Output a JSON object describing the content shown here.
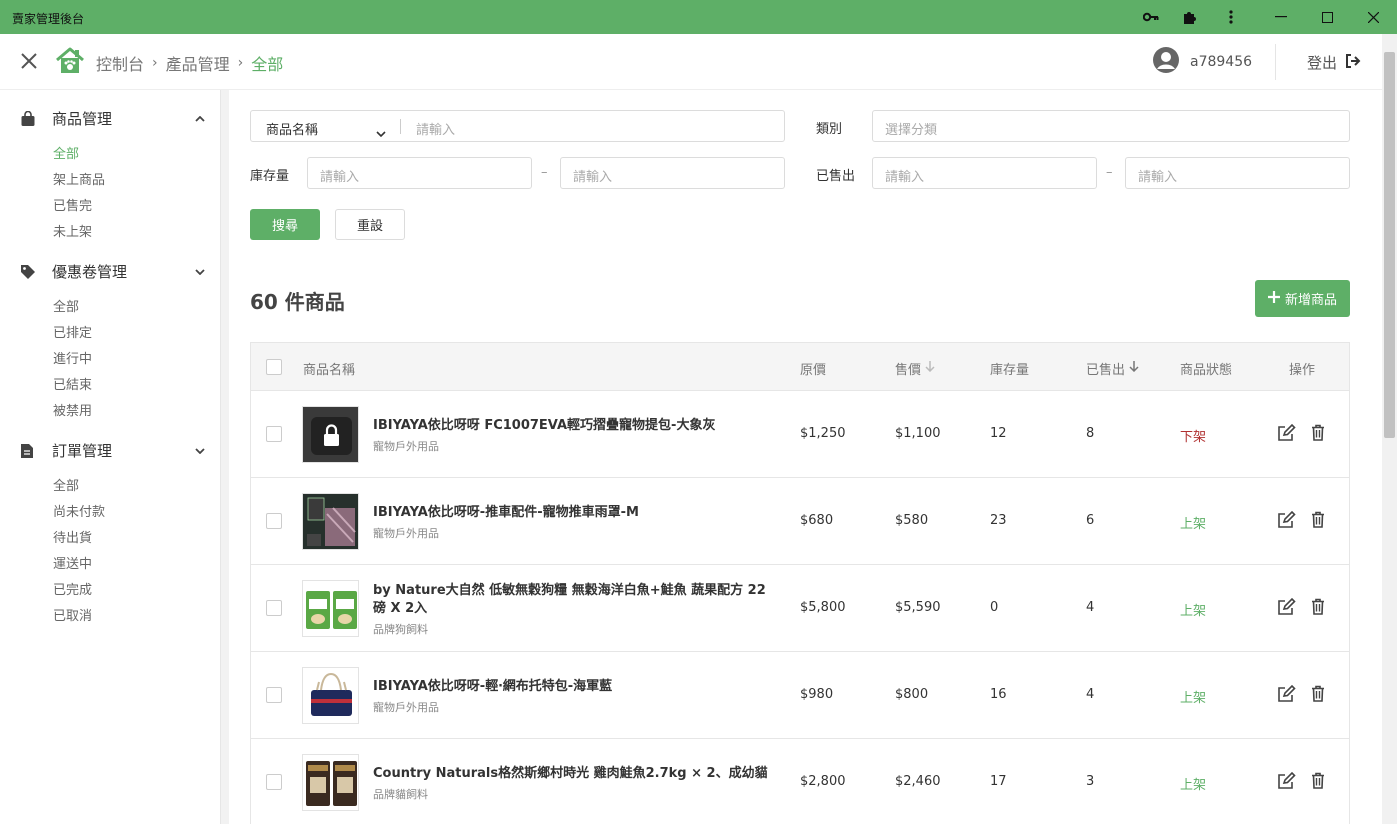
{
  "window": {
    "title": "賣家管理後台"
  },
  "header": {
    "breadcrumb": [
      "控制台",
      "產品管理",
      "全部"
    ],
    "username": "a789456",
    "logout_label": "登出"
  },
  "sidebar": {
    "groups": [
      {
        "label": "商品管理",
        "icon": "shopping-bag-icon",
        "expanded": true,
        "items": [
          "全部",
          "架上商品",
          "已售完",
          "未上架"
        ],
        "active_index": 0
      },
      {
        "label": "優惠卷管理",
        "icon": "tag-icon",
        "expanded": false,
        "items": [
          "全部",
          "已排定",
          "進行中",
          "已結束",
          "被禁用"
        ]
      },
      {
        "label": "訂單管理",
        "icon": "document-icon",
        "expanded": false,
        "items": [
          "全部",
          "尚未付款",
          "待出貨",
          "運送中",
          "已完成",
          "已取消"
        ]
      }
    ]
  },
  "filters": {
    "name_select": "商品名稱",
    "name_placeholder": "請輸入",
    "category_label": "類別",
    "category_placeholder": "選擇分類",
    "stock_label": "庫存量",
    "sold_label": "已售出",
    "range_placeholder": "請輸入",
    "range_dash": "–",
    "search_button": "搜尋",
    "reset_button": "重設"
  },
  "list": {
    "count_title": "60 件商品",
    "add_button": "新增商品"
  },
  "table": {
    "columns": [
      "商品名稱",
      "原價",
      "售價",
      "庫存量",
      "已售出",
      "商品狀態",
      "操作"
    ],
    "rows": [
      {
        "name": "IBIYAYA依比呀呀 FC1007EVA輕巧摺疊寵物提包-大象灰",
        "category": "寵物戶外用品",
        "original_price": "$1,250",
        "price": "$1,100",
        "stock": "12",
        "sold": "8",
        "status": "下架",
        "status_type": "off",
        "thumb": "locked-bag"
      },
      {
        "name": "IBIYAYA依比呀呀-推車配件-寵物推車雨罩-M",
        "category": "寵物戶外用品",
        "original_price": "$680",
        "price": "$580",
        "stock": "23",
        "sold": "6",
        "status": "上架",
        "status_type": "on",
        "thumb": "rain-cover"
      },
      {
        "name": "by Nature大自然 低敏無穀狗糧 無穀海洋白魚+鮭魚 蔬果配方 22磅 X 2入",
        "category": "品牌狗飼料",
        "original_price": "$5,800",
        "price": "$5,590",
        "stock": "0",
        "sold": "4",
        "status": "上架",
        "status_type": "on",
        "thumb": "dog-food"
      },
      {
        "name": "IBIYAYA依比呀呀-輕‧網布托特包-海軍藍",
        "category": "寵物戶外用品",
        "original_price": "$980",
        "price": "$800",
        "stock": "16",
        "sold": "4",
        "status": "上架",
        "status_type": "on",
        "thumb": "tote-bag"
      },
      {
        "name": "Country Naturals格然斯鄉村時光 雞肉鮭魚2.7kg × 2、成幼貓",
        "category": "品牌貓飼料",
        "original_price": "$2,800",
        "price": "$2,460",
        "stock": "17",
        "sold": "3",
        "status": "上架",
        "status_type": "on",
        "thumb": "cat-food"
      }
    ]
  },
  "colors": {
    "accent": "#5eaf67",
    "off_status": "#b03030"
  }
}
